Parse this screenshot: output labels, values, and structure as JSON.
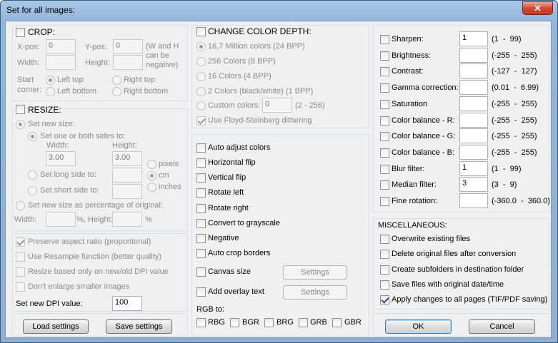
{
  "window": {
    "title": "Set for all images:",
    "close_glyph": "✕"
  },
  "crop": {
    "label": "CROP:",
    "xpos_label": "X-pos:",
    "xpos_value": "0",
    "ypos_label": "Y-pos:",
    "ypos_value": "0",
    "width_label": "Width:",
    "height_label": "Height:",
    "note_line1": "(W and H",
    "note_line2": "can be",
    "note_line3": "negative)",
    "start_corner_label1": "Start",
    "start_corner_label2": "corner:",
    "left_top": "Left top",
    "right_top": "Right top",
    "left_bottom": "Left bottom",
    "right_bottom": "Right bottom"
  },
  "resize": {
    "label": "RESIZE:",
    "set_new_size": "Set new size:",
    "set_one_or_both": "Set one or both sides to:",
    "width_label": "Width:",
    "height_label": "Height:",
    "width_value": "3.00",
    "height_value": "3.00",
    "unit_pixels": "pixels",
    "unit_cm": "cm",
    "unit_inches": "inches",
    "long_side": "Set long side to:",
    "short_side": "Set short side to:",
    "percentage": "Set new size as percentage of original:",
    "pct_width_label": "Width:",
    "pct_mid_label": "%, Height:",
    "pct_end_label": "%"
  },
  "options": {
    "preserve_aspect": "Preserve aspect ratio (proportional)",
    "use_resample": "Use Resample function (better quality)",
    "resize_dpi": "Resize based only on new/old DPI value",
    "dont_enlarge": "Don't enlarge smaller images",
    "dpi_label": "Set new DPI value:",
    "dpi_value": "100"
  },
  "color_depth": {
    "label": "CHANGE COLOR DEPTH:",
    "opt1": "16,7 Million colors (24 BPP)",
    "opt2": "256 Colors (8 BPP)",
    "opt3": "16 Colors (4 BPP)",
    "opt4": "2 Colors (black/white) (1 BPP)",
    "custom_label": "Custom colors:",
    "custom_value": "0",
    "custom_range": "(2 - 256)",
    "dithering": "Use Floyd-Steinberg dithering"
  },
  "transforms": {
    "auto_adjust": "Auto adjust colors",
    "hflip": "Horizontal flip",
    "vflip": "Vertical flip",
    "rot_left": "Rotate left",
    "rot_right": "Rotate right",
    "grayscale": "Convert to grayscale",
    "negative": "Negative",
    "autocrop": "Auto crop borders",
    "canvas": "Canvas size",
    "overlay": "Add overlay text",
    "settings": "Settings",
    "rgb_label": "RGB to:",
    "rbg": "RBG",
    "bgr": "BGR",
    "brg": "BRG",
    "grb": "GRB",
    "gbr": "GBR"
  },
  "adjust": [
    {
      "label": "Sharpen:",
      "value": "1",
      "range": "(1  -  99)"
    },
    {
      "label": "Brightness:",
      "value": "",
      "range": "(-255  -  255)"
    },
    {
      "label": "Contrast:",
      "value": "",
      "range": "(-127  -  127)"
    },
    {
      "label": "Gamma correction:",
      "value": "",
      "range": "(0.01  -  6.99)"
    },
    {
      "label": "Saturation",
      "value": "",
      "range": "(-255  -  255)"
    },
    {
      "label": "Color balance - R:",
      "value": "",
      "range": "(-255  -  255)"
    },
    {
      "label": "Color balance - G:",
      "value": "",
      "range": "(-255  -  255)"
    },
    {
      "label": "Color balance - B:",
      "value": "",
      "range": "(-255  -  255)"
    },
    {
      "label": "Blur filter:",
      "value": "1",
      "range": "(1  -  99)"
    },
    {
      "label": "Median filter:",
      "value": "3",
      "range": "(3  -  9)"
    },
    {
      "label": "Fine rotation:",
      "value": "",
      "range": "(-360.0  -  360.0)"
    }
  ],
  "misc": {
    "label": "MISCELLANEOUS:",
    "overwrite": "Overwrite existing files",
    "delete_orig": "Delete original files after conversion",
    "subfolders": "Create subfolders in destination folder",
    "save_date": "Save files with original date/time",
    "apply_all": "Apply changes to all pages (TIF/PDF saving)"
  },
  "buttons": {
    "load": "Load settings",
    "save": "Save settings",
    "ok": "OK",
    "cancel": "Cancel"
  }
}
